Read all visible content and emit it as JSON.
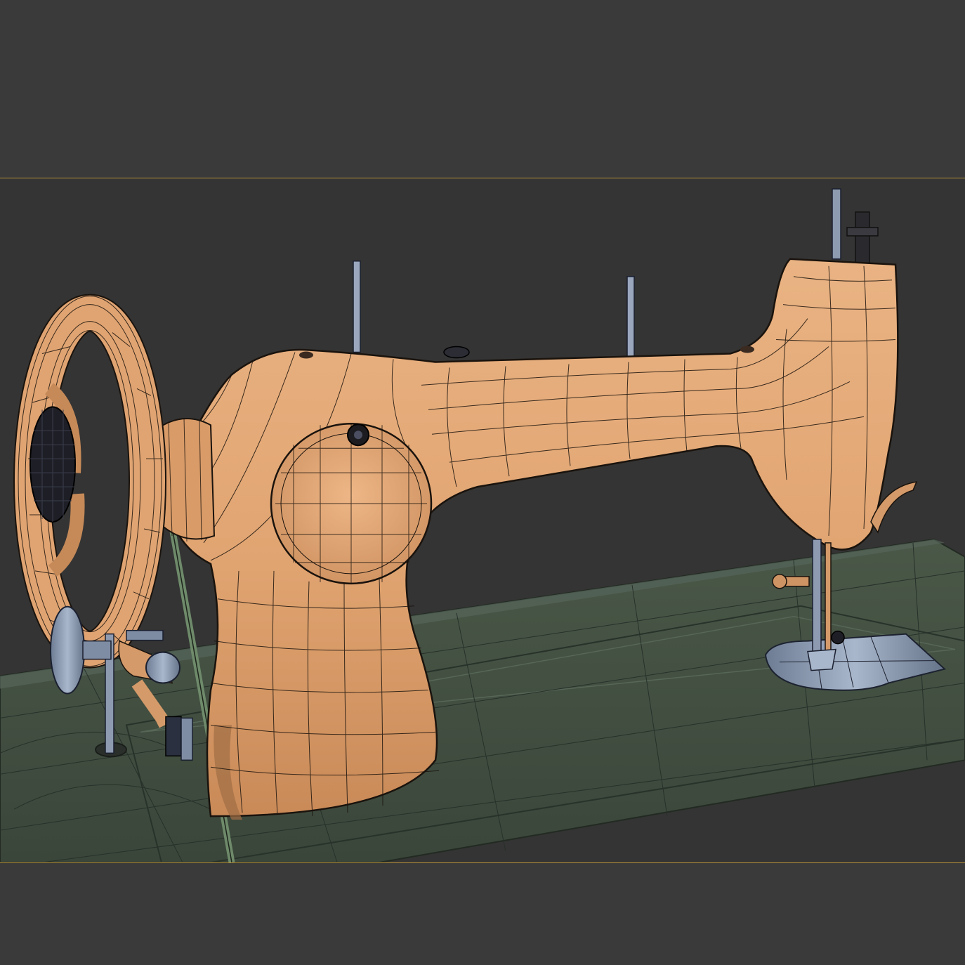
{
  "scene": {
    "colors": {
      "background": "#3a3a3a",
      "viewport_frame": "#b7913a",
      "table": "#3f4b3e",
      "body": "#e3a774",
      "metal": "#8fa0b8",
      "wire": "#15120f",
      "grid_line": "#27302a"
    }
  }
}
